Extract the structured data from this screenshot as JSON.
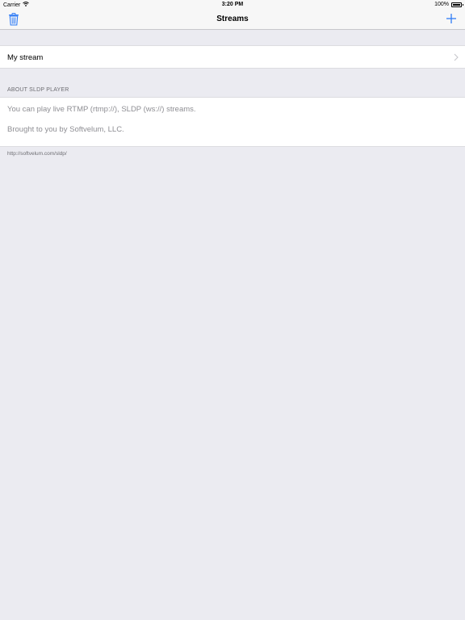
{
  "status_bar": {
    "carrier": "Carrier",
    "time": "3:20 PM",
    "battery": "100%",
    "battery_level": 1.0
  },
  "nav": {
    "title": "Streams",
    "left_icon": "trash-icon",
    "right_icon": "plus-icon",
    "accent_color": "#2f7cf6"
  },
  "streams": [
    {
      "label": "My stream"
    }
  ],
  "about": {
    "header": "ABOUT SLDP PLAYER",
    "lines": [
      "You can play live RTMP (rtmp://), SLDP (ws://) streams.",
      "Brought to you by Softvelum, LLC."
    ],
    "link": "http://softvelum.com/sldp/"
  },
  "colors": {
    "background": "#ebebf1",
    "bar": "#f7f7f7",
    "secondary_text": "#8e8e93"
  }
}
